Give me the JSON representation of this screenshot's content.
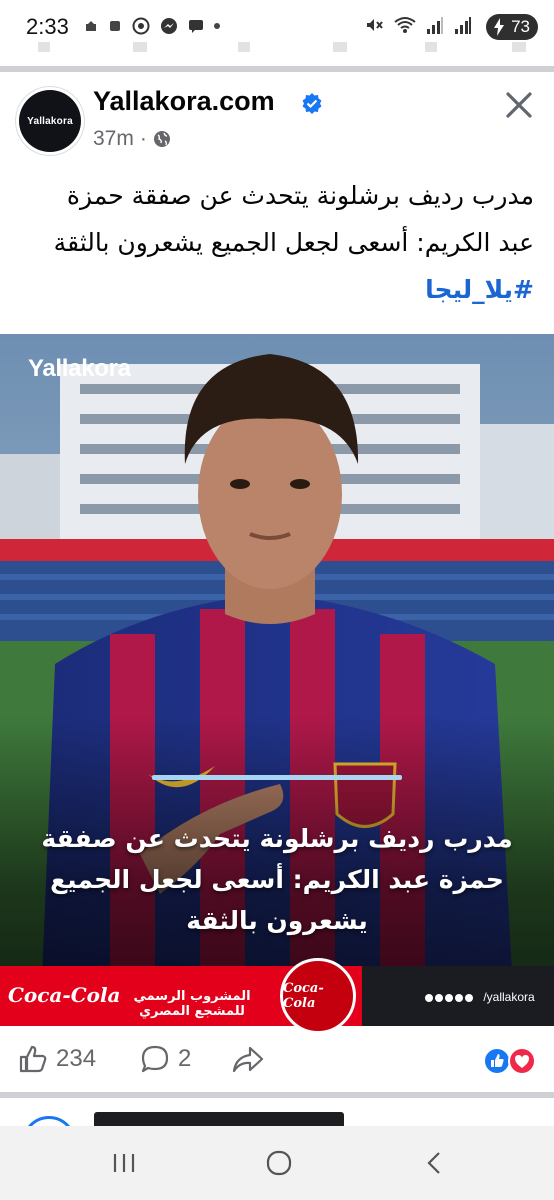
{
  "status_bar": {
    "time": "2:33",
    "battery": "73"
  },
  "post": {
    "page_name": "Yallakora.com",
    "avatar_text": "Yallakora",
    "timestamp": "37m",
    "caption_line1": "مدرب رديف برشلونة يتحدث عن صفقة حمزة",
    "caption_line2": "عبد الكريم: أسعى لجعل الجميع يشعرون بالثقة",
    "hashtag": "#يلا_ليجا",
    "image": {
      "watermark": "Yallakora",
      "overlay_line1": "مدرب رديف برشلونة يتحدث عن صفقة",
      "overlay_line2": "حمزة عبد الكريم: أسعى لجعل الجميع",
      "overlay_line3": "يشعرون بالثقة",
      "ad_left_logo": "Coca-Cola",
      "ad_text": "المشروب الرسمي للمشجع المصري",
      "ad_ball_logo": "Coca-Cola",
      "social_handle": "/yallakora"
    },
    "likes_count": "234",
    "comments_count": "2"
  },
  "colors": {
    "hashtag": "#1b66d2",
    "verified": "#1877f2",
    "ad_red": "#e2001a"
  }
}
